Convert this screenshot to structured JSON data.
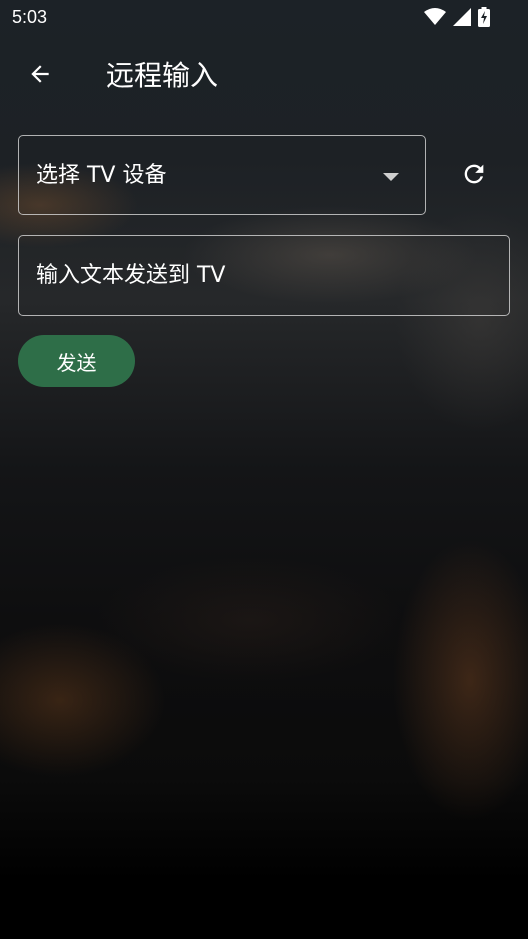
{
  "status_bar": {
    "time": "5:03",
    "icons": [
      "wifi-icon",
      "signal-icon",
      "battery-charging-icon"
    ]
  },
  "app_bar": {
    "back_icon": "arrow-left-icon",
    "title": "远程输入"
  },
  "device_selector": {
    "label": "选择 TV 设备",
    "arrow_icon": "dropdown-arrow-icon"
  },
  "refresh": {
    "icon": "refresh-icon"
  },
  "text_input": {
    "value": "",
    "placeholder": "输入文本发送到 TV"
  },
  "send_button": {
    "label": "发送"
  },
  "colors": {
    "accent": "#2e6e48",
    "text": "#ffffff",
    "outline": "#d7d7d7"
  }
}
